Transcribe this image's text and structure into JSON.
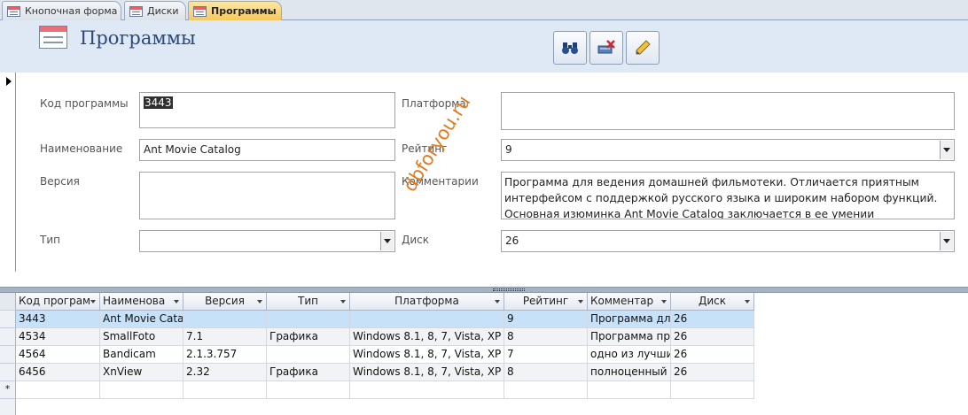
{
  "tabs": [
    {
      "label": "Кнопочная форма"
    },
    {
      "label": "Диски"
    },
    {
      "label": "Программы"
    }
  ],
  "header": {
    "title": "Программы",
    "buttons": [
      "binoculars-icon",
      "delete-record-icon",
      "pencil-icon"
    ]
  },
  "form": {
    "code_label": "Код программы",
    "code_value": "3443",
    "name_label": "Наименование",
    "name_value": "Ant Movie Catalog",
    "version_label": "Версия",
    "version_value": "",
    "type_label": "Тип",
    "type_value": "",
    "platform_label": "Платформа",
    "platform_value": "",
    "rating_label": "Рейтинг",
    "rating_value": "9",
    "comment_label": "Комментарии",
    "comment_value": "Программа для ведения домашней фильмотеки. Отличается приятным интерфейсом с поддержкой русского языка и широким набором функций. Основная изюминка Ant Movie Catalog заключается в ее умении",
    "disk_label": "Диск",
    "disk_value": "26"
  },
  "watermark": "dbforyou.ru",
  "grid": {
    "headers": [
      "Код програм",
      "Наименова",
      "Версия",
      "Тип",
      "Платформа",
      "Рейтинг",
      "Комментар",
      "Диск"
    ],
    "rows": [
      [
        "3443",
        "Ant Movie Cata",
        "",
        "",
        "",
        "9",
        "Программа дл",
        "26"
      ],
      [
        "4534",
        "SmallFoto",
        "7.1",
        "Графика",
        "Windows 8.1, 8, 7, Vista, XP",
        "8",
        "Программа пр",
        "26"
      ],
      [
        "4564",
        "Bandicam",
        "2.1.3.757",
        "",
        "Windows 8.1, 8, 7, Vista, XP",
        "7",
        "одно из лучши",
        "26"
      ],
      [
        "6456",
        "XnView",
        "2.32",
        "Графика",
        "Windows 8.1, 8, 7, Vista, XP",
        "8",
        "полноценный",
        "26"
      ]
    ],
    "new_row_marker": "*"
  }
}
